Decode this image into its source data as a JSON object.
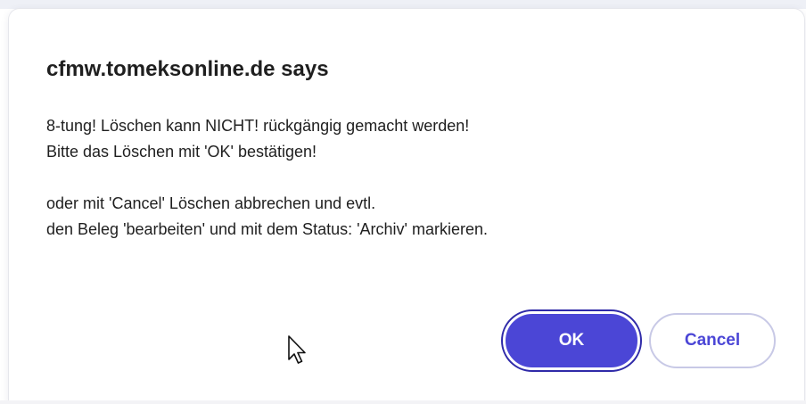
{
  "dialog": {
    "title": "cfmw.tomeksonline.de says",
    "message_lines": [
      "8-tung! Löschen kann NICHT! rückgängig gemacht werden!",
      "Bitte das Löschen mit 'OK' bestätigen!",
      "",
      "oder mit 'Cancel' Löschen abbrechen und evtl.",
      "den Beleg 'bearbeiten' und mit dem Status: 'Archiv' markieren."
    ],
    "ok_label": "OK",
    "cancel_label": "Cancel"
  },
  "colors": {
    "accent": "#4b46d6",
    "focus_ring": "#2f2aa8",
    "text": "#1f1f1f"
  },
  "icons": {
    "cursor": "mouse-pointer-icon"
  }
}
